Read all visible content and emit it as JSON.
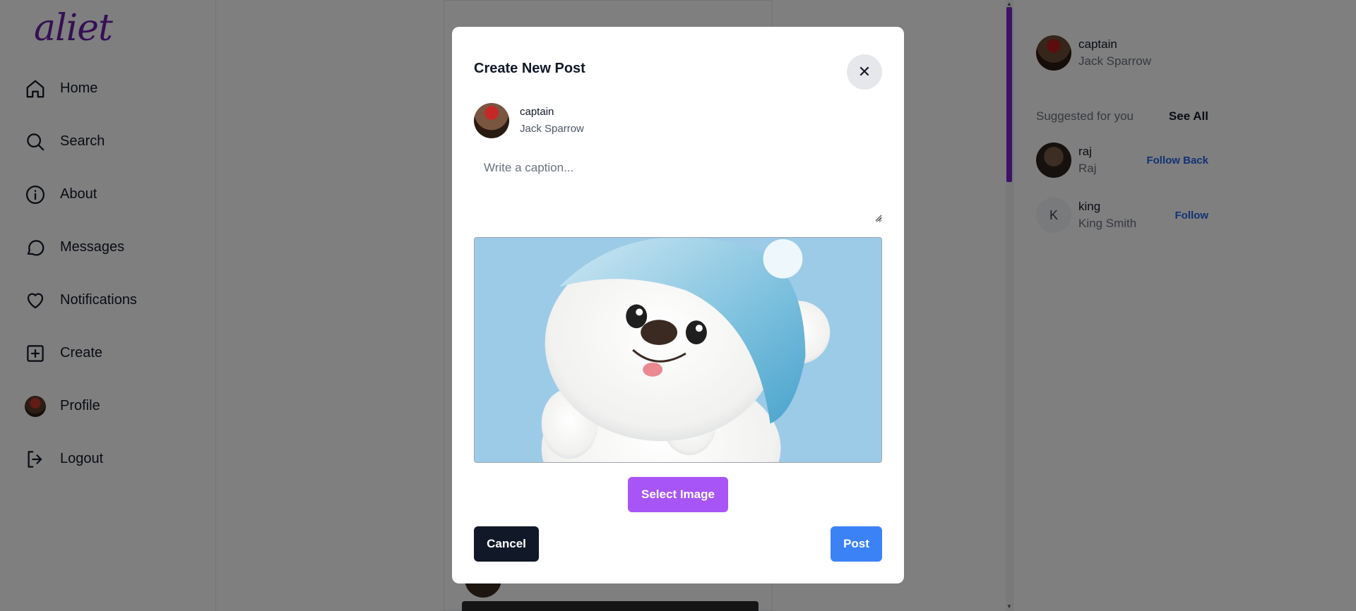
{
  "app": {
    "logo_text": "aliet"
  },
  "sidebar": {
    "items": [
      {
        "label": "Home",
        "icon": "home-icon"
      },
      {
        "label": "Search",
        "icon": "search-icon"
      },
      {
        "label": "About",
        "icon": "info-icon"
      },
      {
        "label": "Messages",
        "icon": "message-icon"
      },
      {
        "label": "Notifications",
        "icon": "heart-icon"
      },
      {
        "label": "Create",
        "icon": "plus-square-icon"
      },
      {
        "label": "Profile",
        "icon": "avatar"
      },
      {
        "label": "Logout",
        "icon": "logout-icon"
      }
    ]
  },
  "rightbar": {
    "me": {
      "username": "captain",
      "fullname": "Jack Sparrow"
    },
    "suggested_label": "Suggested for you",
    "see_all": "See All",
    "suggestions": [
      {
        "username": "raj",
        "fullname": "Raj",
        "action": "Follow Back"
      },
      {
        "username": "king",
        "fullname": "King Smith",
        "action": "Follow",
        "initial": "K"
      }
    ]
  },
  "modal": {
    "title": "Create New Post",
    "close_glyph": "✕",
    "user": {
      "username": "captain",
      "fullname": "Jack Sparrow"
    },
    "caption": {
      "value": "",
      "placeholder": "Write a caption..."
    },
    "select_image_label": "Select Image",
    "cancel_label": "Cancel",
    "post_label": "Post"
  },
  "colors": {
    "accent_purple": "#a855f7",
    "post_blue": "#3b82f6",
    "cancel_dark": "#111827",
    "follow_blue": "#2563eb",
    "logo_purple": "#6b21a8",
    "overlay": "rgba(0,0,0,0.5)"
  }
}
